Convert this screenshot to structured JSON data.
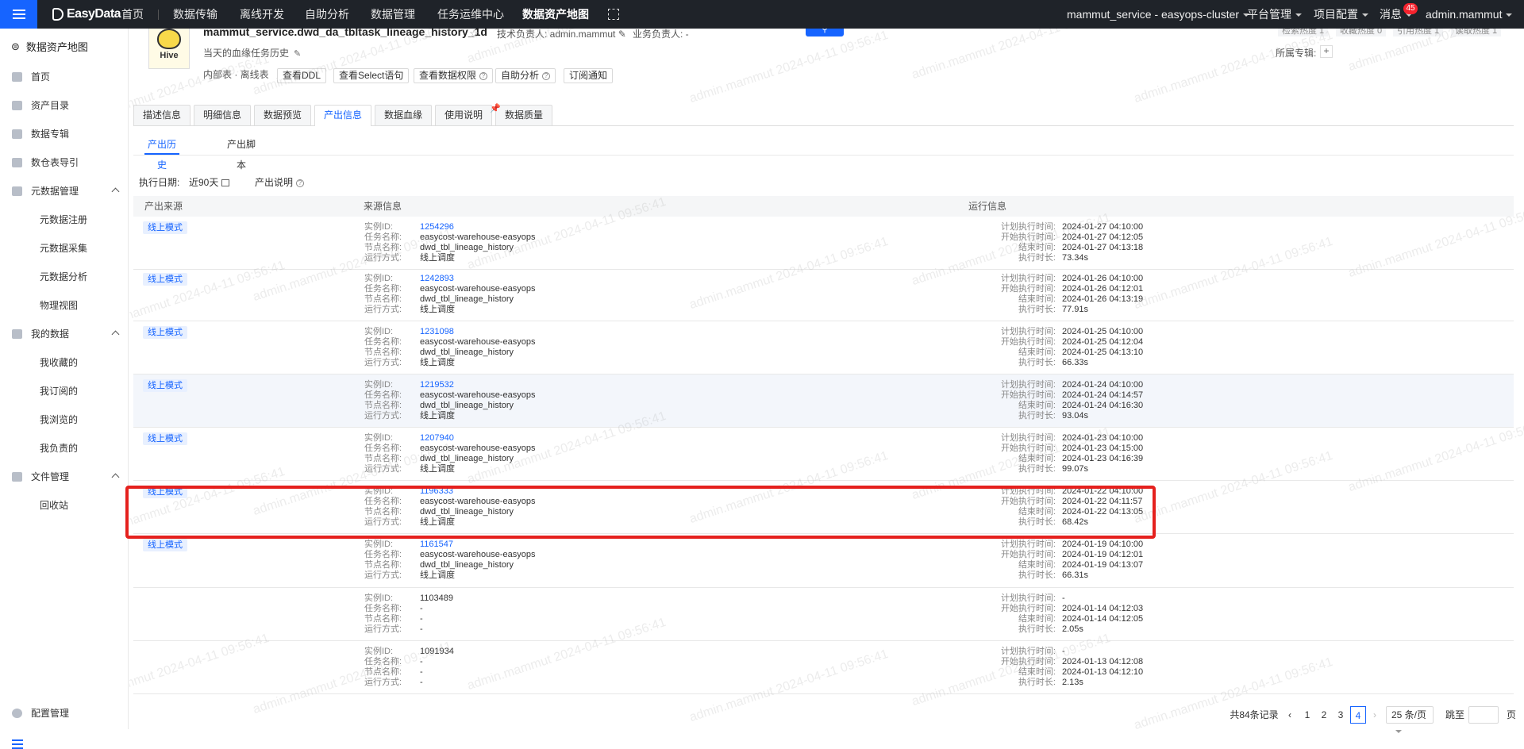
{
  "topbar": {
    "logo_text": "EasyData",
    "nav": [
      "首页",
      "数据传输",
      "离线开发",
      "自助分析",
      "数据管理",
      "任务运维中心",
      "数据资产地图"
    ],
    "active_nav": "数据资产地图",
    "cluster": "mammut_service - easyops-cluster",
    "platform_mgmt": "平台管理",
    "project_config": "项目配置",
    "messages": "消息",
    "message_count": "45",
    "user": "admin.mammut"
  },
  "sidebar": {
    "title": "数据资产地图",
    "items": [
      {
        "label": "首页",
        "icon": "home-icon"
      },
      {
        "label": "资产目录",
        "icon": "catalog-icon"
      },
      {
        "label": "数据专辑",
        "icon": "album-icon"
      },
      {
        "label": "数仓表导引",
        "icon": "warehouse-icon"
      },
      {
        "label": "元数据管理",
        "icon": "grid-icon",
        "expanded": true,
        "children": [
          "元数据注册",
          "元数据采集",
          "元数据分析",
          "物理视图"
        ]
      },
      {
        "label": "我的数据",
        "icon": "user-icon",
        "expanded": true,
        "children": [
          "我收藏的",
          "我订阅的",
          "我浏览的",
          "我负责的"
        ]
      },
      {
        "label": "文件管理",
        "icon": "folder-icon",
        "expanded": true,
        "children": [
          "回收站"
        ]
      }
    ],
    "config": "配置管理"
  },
  "header": {
    "logo_text": "Hive",
    "table_name": "mammut_service.dwd_da_tbltask_lineage_history_1d",
    "tech_owner": "技术负责人: admin.mammut",
    "biz_owner": "业务负责人: -",
    "description": "当天的血缘任务历史",
    "stats": [
      "检索热度 1",
      "收藏热度 0",
      "引用热度 1",
      "读取热度 1"
    ],
    "subject_label": "所属专辑:",
    "subject_add": "+",
    "meta": "内部表 · 离线表",
    "actions": [
      "查看DDL",
      "查看Select语句",
      "查看数据权限",
      "自助分析",
      "订阅通知"
    ]
  },
  "tabs": [
    "描述信息",
    "明细信息",
    "数据预览",
    "产出信息",
    "数据血缘",
    "使用说明",
    "数据质量"
  ],
  "active_tab": "产出信息",
  "subtabs": [
    "产出历史",
    "产出脚本"
  ],
  "active_subtab": "产出历史",
  "filter": {
    "label": "执行日期:",
    "value": "近90天",
    "explain": "产出说明"
  },
  "table": {
    "headers": [
      "产出来源",
      "来源信息",
      "运行信息"
    ],
    "src_keys": [
      "实例ID:",
      "任务名称:",
      "节点名称:",
      "运行方式:"
    ],
    "run_keys": [
      "计划执行时间:",
      "开始执行时间:",
      "结束时间:",
      "执行时长:"
    ],
    "rows": [
      {
        "mode": "线上模式",
        "id": "1254296",
        "task": "easycost-warehouse-easyops",
        "node": "dwd_tbl_lineage_history",
        "run": "线上调度",
        "plan": "2024-01-27 04:10:00",
        "start": "2024-01-27 04:12:05",
        "end": "2024-01-27 04:13:18",
        "dur": "73.34s"
      },
      {
        "mode": "线上模式",
        "id": "1242893",
        "task": "easycost-warehouse-easyops",
        "node": "dwd_tbl_lineage_history",
        "run": "线上调度",
        "plan": "2024-01-26 04:10:00",
        "start": "2024-01-26 04:12:01",
        "end": "2024-01-26 04:13:19",
        "dur": "77.91s"
      },
      {
        "mode": "线上模式",
        "id": "1231098",
        "task": "easycost-warehouse-easyops",
        "node": "dwd_tbl_lineage_history",
        "run": "线上调度",
        "plan": "2024-01-25 04:10:00",
        "start": "2024-01-25 04:12:04",
        "end": "2024-01-25 04:13:10",
        "dur": "66.33s"
      },
      {
        "mode": "线上模式",
        "id": "1219532",
        "task": "easycost-warehouse-easyops",
        "node": "dwd_tbl_lineage_history",
        "run": "线上调度",
        "plan": "2024-01-24 04:10:00",
        "start": "2024-01-24 04:14:57",
        "end": "2024-01-24 04:16:30",
        "dur": "93.04s"
      },
      {
        "mode": "线上模式",
        "id": "1207940",
        "task": "easycost-warehouse-easyops",
        "node": "dwd_tbl_lineage_history",
        "run": "线上调度",
        "plan": "2024-01-23 04:10:00",
        "start": "2024-01-23 04:15:00",
        "end": "2024-01-23 04:16:39",
        "dur": "99.07s"
      },
      {
        "mode": "线上模式",
        "id": "1196333",
        "task": "easycost-warehouse-easyops",
        "node": "dwd_tbl_lineage_history",
        "run": "线上调度",
        "plan": "2024-01-22 04:10:00",
        "start": "2024-01-22 04:11:57",
        "end": "2024-01-22 04:13:05",
        "dur": "68.42s"
      },
      {
        "mode": "线上模式",
        "id": "1161547",
        "task": "easycost-warehouse-easyops",
        "node": "dwd_tbl_lineage_history",
        "run": "线上调度",
        "plan": "2024-01-19 04:10:00",
        "start": "2024-01-19 04:12:01",
        "end": "2024-01-19 04:13:07",
        "dur": "66.31s"
      },
      {
        "mode": "",
        "id": "1103489",
        "task": "-",
        "node": "-",
        "run": "-",
        "plan": "-",
        "start": "2024-01-14 04:12:03",
        "end": "2024-01-14 04:12:05",
        "dur": "2.05s"
      },
      {
        "mode": "",
        "id": "1091934",
        "task": "-",
        "node": "-",
        "run": "-",
        "plan": "-",
        "start": "2024-01-13 04:12:08",
        "end": "2024-01-13 04:12:10",
        "dur": "2.13s"
      }
    ]
  },
  "pagination": {
    "total": "共84条记录",
    "pages": [
      "1",
      "2",
      "3",
      "4"
    ],
    "current": "4",
    "page_size": "25 条/页",
    "goto": "跳至",
    "goto_suffix": "页"
  },
  "watermark": "admin.mammut 2024-04-11 09:56:41",
  "colors": {
    "accent": "#1664ff",
    "topbar": "#1f2329",
    "highlight": "#e5211e"
  }
}
